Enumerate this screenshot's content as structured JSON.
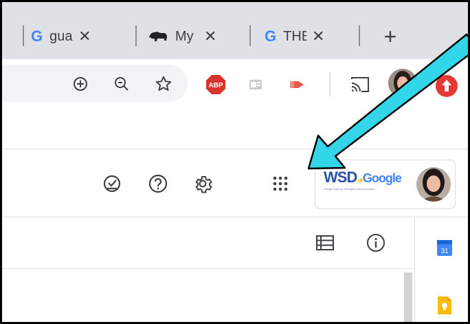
{
  "tabs": [
    {
      "title": "gua",
      "close": "✕",
      "icon": "google-g-icon",
      "logo_text": "G"
    },
    {
      "title": "My",
      "close": "✕",
      "icon": "bison-icon"
    },
    {
      "title": "THE",
      "close": "✕",
      "icon": "google-g-icon",
      "logo_text": "G"
    }
  ],
  "new_tab_label": "+",
  "toolbar": {
    "zoom_in_icon": "zoom-in-icon",
    "zoom_out_icon": "zoom-out-icon",
    "bookmark_icon": "star-icon",
    "extensions": [
      {
        "name": "adblock-plus-icon",
        "text": "ABP",
        "color": "#d9342b"
      },
      {
        "name": "outlook-extension-icon",
        "color": "#9aa0a6"
      },
      {
        "name": "cast-share-extension-icon",
        "color": "#e45a4a"
      },
      {
        "name": "cast-icon"
      },
      {
        "name": "profile-avatar"
      },
      {
        "name": "red-extension-icon",
        "color": "#e53935"
      }
    ]
  },
  "header": {
    "icons": [
      "tasks-check-icon",
      "help-icon",
      "settings-gear-icon",
      "apps-grid-icon"
    ],
    "account": {
      "logo_letters": [
        "W",
        "S",
        "D",
        "Google"
      ],
      "logo_joiner": "of",
      "logo_sub": "Google Apps for Winnipeg School Division",
      "colors": {
        "wsd": "#2b4fa8",
        "google_blue": "#4285f4",
        "google_red": "#ea4335",
        "google_yellow": "#fbbc05",
        "google_green": "#34a853"
      }
    }
  },
  "content": {
    "toolbar_icons": [
      "list-view-icon",
      "info-icon"
    ]
  },
  "side_panel": {
    "apps": [
      {
        "name": "calendar-app-icon",
        "text": "31",
        "color": "#4285f4"
      },
      {
        "name": "keep-app-icon",
        "color": "#fbbc05"
      }
    ]
  },
  "annotation": {
    "arrow_color": "#33d6e8"
  }
}
